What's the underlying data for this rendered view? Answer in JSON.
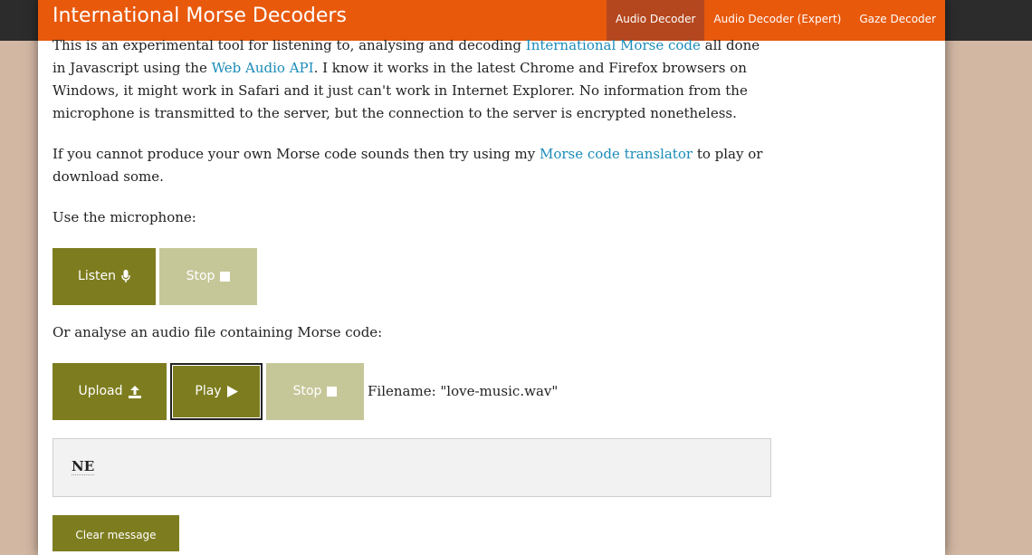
{
  "header": {
    "title": "International Morse Decoders",
    "nav": [
      "Audio Decoder",
      "Audio Decoder (Expert)",
      "Gaze Decoder"
    ]
  },
  "intro": {
    "t1": "This is an experimental tool for listening to, analysing and decoding ",
    "link1": "International Morse code",
    "t2": " all done in Javascript using the ",
    "link2": "Web Audio API",
    "t3": ". I know it works in the latest Chrome and Firefox browsers on Windows, it might work in Safari and it just can't work in Internet Explorer. No information from the microphone is transmitted to the server, but the connection to the server is encrypted nonetheless."
  },
  "translator": {
    "t1": "If you cannot produce your own Morse code sounds then try using my ",
    "link": "Morse code translator",
    "t2": " to play or download some."
  },
  "microphone": {
    "label": "Use the microphone:",
    "listen": "Listen",
    "stop": "Stop"
  },
  "file": {
    "label": "Or analyse an audio file containing Morse code:",
    "upload": "Upload",
    "play": "Play",
    "stop": "Stop",
    "filename": "Filename: \"love-music.wav\""
  },
  "output": {
    "message": "NE"
  },
  "clear_label": "Clear message",
  "colors": {
    "header": "#e8590c",
    "nav_active": "#b4471e",
    "button": "#7d7d1f",
    "button_disabled": "#c6c799",
    "link": "#1a8bb8"
  }
}
